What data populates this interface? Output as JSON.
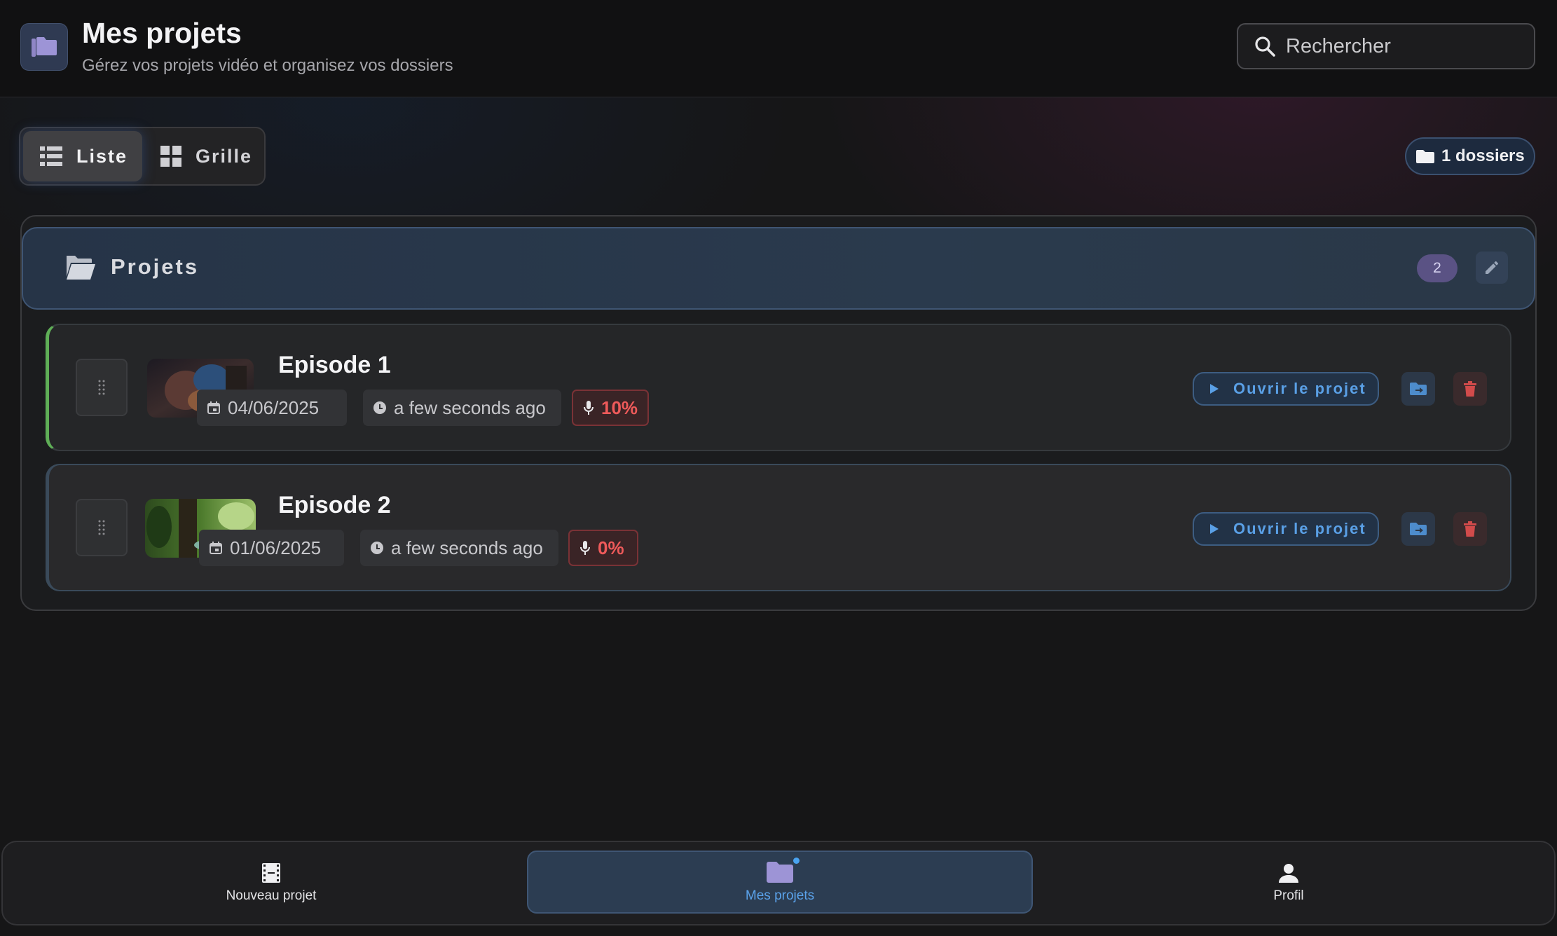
{
  "header": {
    "title": "Mes projets",
    "subtitle": "Gérez vos projets vidéo et organisez vos dossiers",
    "search_placeholder": "Rechercher"
  },
  "view_toggle": {
    "list_label": "Liste",
    "grid_label": "Grille",
    "selected": "Liste"
  },
  "folders_count_label": "1 dossiers",
  "folder": {
    "name": "Projets",
    "count": "2"
  },
  "projects": [
    {
      "title": "Episode 1",
      "date": "04/06/2025",
      "updated": "a few seconds ago",
      "progress": "10%",
      "accent": "#5fae57"
    },
    {
      "title": "Episode 2",
      "date": "01/06/2025",
      "updated": "a few seconds ago",
      "progress": "0%",
      "accent": "#2f4a66"
    }
  ],
  "row_actions": {
    "open_label": "Ouvrir le projet"
  },
  "bottom_nav": {
    "items": [
      {
        "label": "Nouveau projet",
        "icon": "film-icon"
      },
      {
        "label": "Mes projets",
        "icon": "folder-icon",
        "active": true
      },
      {
        "label": "Profil",
        "icon": "person-icon"
      }
    ]
  },
  "colors": {
    "accent_blue": "#5aa0e6",
    "danger": "#ee5a5a",
    "badge_purple": "#5a5284"
  }
}
